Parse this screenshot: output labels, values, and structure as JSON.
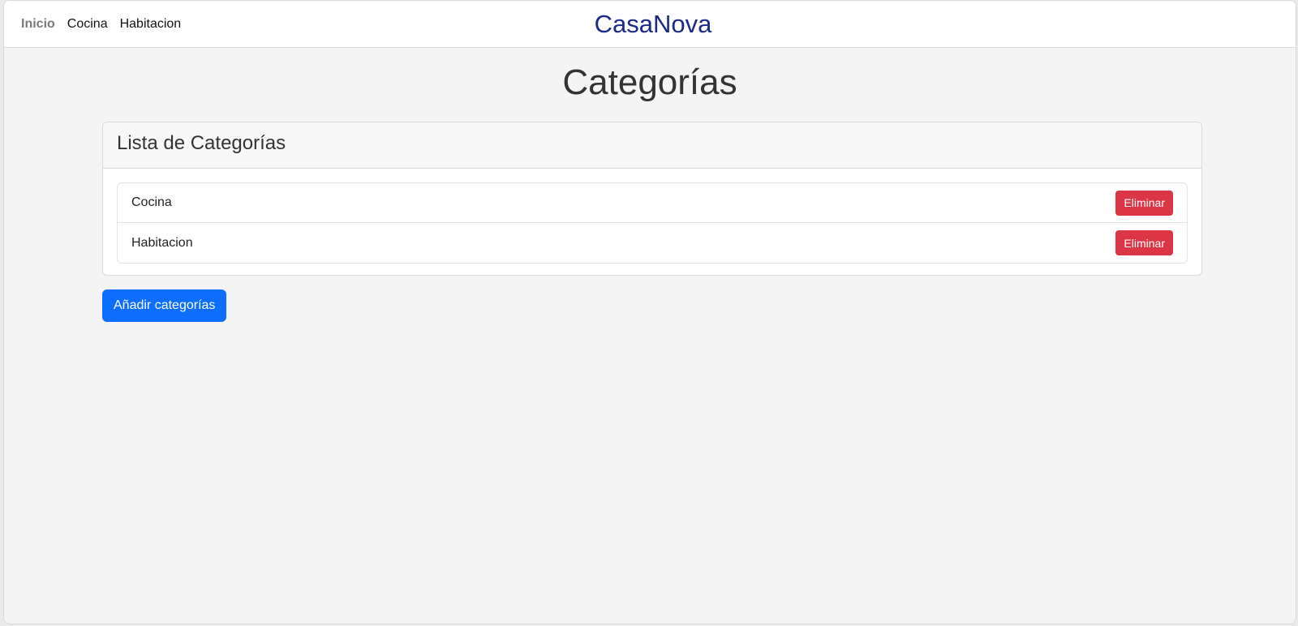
{
  "navbar": {
    "links": [
      {
        "label": "Inicio",
        "active": true
      },
      {
        "label": "Cocina",
        "active": false
      },
      {
        "label": "Habitacion",
        "active": false
      }
    ],
    "brand": "CasaNova"
  },
  "page": {
    "title": "Categorías"
  },
  "card": {
    "header": "Lista de Categorías",
    "items": [
      {
        "label": "Cocina",
        "button": "Eliminar"
      },
      {
        "label": "Habitacion",
        "button": "Eliminar"
      }
    ]
  },
  "actions": {
    "add_label": "Añadir categorías"
  },
  "colors": {
    "brand": "#1b2a86",
    "primary": "#0d6efd",
    "danger": "#dc3545",
    "background": "#f4f4f4"
  }
}
